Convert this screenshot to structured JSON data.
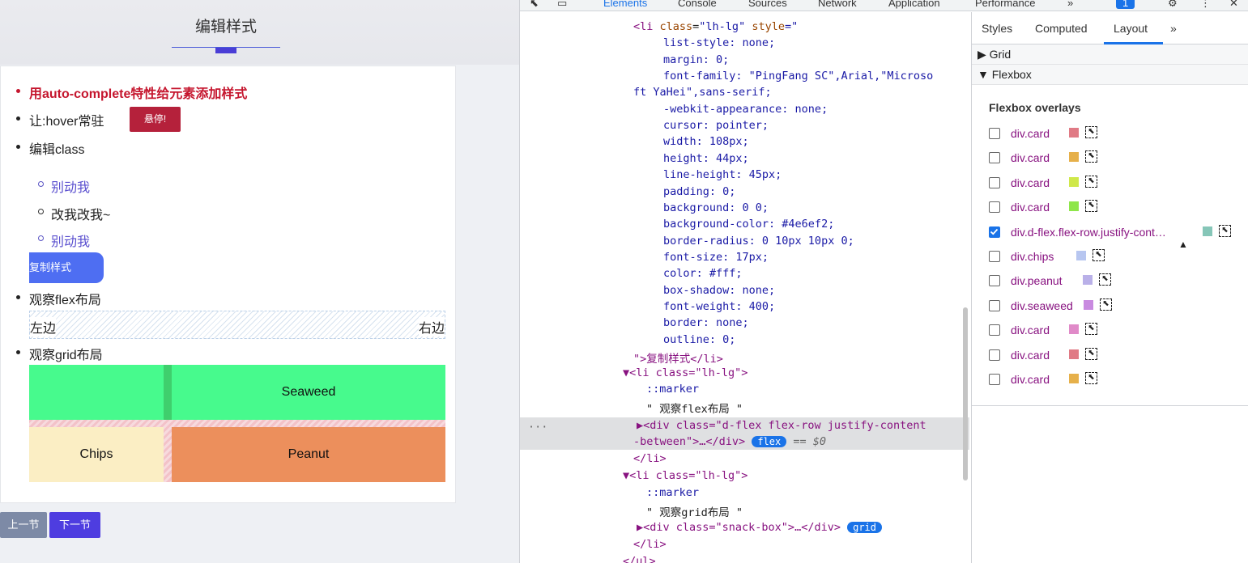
{
  "page": {
    "title": "编辑样式",
    "items": {
      "autocomplete": "用auto-complete特性给元素添加样式",
      "hover": "让:hover常驻",
      "hover_btn": "悬停!",
      "edit_class": "编辑class",
      "sub1": "别动我",
      "sub2": "改我改我~",
      "sub3": "别动我",
      "copy_btn": "复制样式",
      "flex_title": "观察flex布局",
      "flex_left": "左边",
      "flex_right": "右边",
      "grid_title": "观察grid布局",
      "seaweed": "Seaweed",
      "chips": "Chips",
      "peanut": "Peanut"
    },
    "prev": "上一节",
    "next": "下一节"
  },
  "devtools": {
    "tabs": [
      "Elements",
      "Console",
      "Sources",
      "Network",
      "Application",
      "Performance",
      "»"
    ],
    "issues_count": "1",
    "code": {
      "l1_tag": "<li ",
      "l1_attr": "class",
      "l1_val": "\"lh-lg\"",
      "l1_style": " style",
      "l1_eq": "=\"",
      "css1": "list-style: none;",
      "css2": "margin: 0;",
      "css3": "font-family: \"PingFang SC\",Arial,\"Microso",
      "css3b": "ft YaHei\",sans-serif;",
      "css4": "-webkit-appearance: none;",
      "css5": "cursor: pointer;",
      "css6": "width: 108px;",
      "css7": "height: 44px;",
      "css8": "line-height: 45px;",
      "css9": "padding: 0;",
      "css10": "background: 0 0;",
      "css11": "background-color: #4e6ef2;",
      "css12": "border-radius: 0 10px 10px 0;",
      "css13": "font-size: 17px;",
      "css14": "color: #fff;",
      "css15": "box-shadow: none;",
      "css16": "font-weight: 400;",
      "css17": "border: none;",
      "css18": "outline: 0;",
      "close1": "\">复制样式</li>",
      "li2": "▼<li class=\"lh-lg\">",
      "marker1": "::marker",
      "text1": "\" 观察flex布局 \"",
      "div1a": "▶<div class=\"d-flex flex-row justify-content",
      "div1b": "-between\">…</div>",
      "flex_badge": "flex",
      "eq0": "== $0",
      "endli1": "</li>",
      "li3": "▼<li class=\"lh-lg\">",
      "marker2": "::marker",
      "text2": "\" 观察grid布局 \"",
      "div2": "▶<div class=\"snack-box\">…</div>",
      "grid_badge": "grid",
      "endli2": "</li>",
      "endul": "</ul>",
      "dots": "···"
    },
    "side": {
      "tabs": [
        "Styles",
        "Computed",
        "Layout",
        "»"
      ],
      "grid": "▶ Grid",
      "flexbox": "▼ Flexbox",
      "overlays_title": "Flexbox overlays",
      "overlays": [
        {
          "label": "div.card",
          "color": "#e07a85",
          "checked": false
        },
        {
          "label": "div.card",
          "color": "#e6b04a",
          "checked": false
        },
        {
          "label": "div.card",
          "color": "#cfe84a",
          "checked": false
        },
        {
          "label": "div.card",
          "color": "#8ee64a",
          "checked": false
        },
        {
          "label": "div.d-flex.flex-row.justify-cont…",
          "color": "#86c6b8",
          "checked": true
        },
        {
          "label": "div.chips",
          "color": "#b7c6f0",
          "checked": false
        },
        {
          "label": "div.peanut",
          "color": "#b9b0e8",
          "checked": false
        },
        {
          "label": "div.seaweed",
          "color": "#c98ae0",
          "checked": false
        },
        {
          "label": "div.card",
          "color": "#e08ac8",
          "checked": false
        },
        {
          "label": "div.card",
          "color": "#e07a85",
          "checked": false
        },
        {
          "label": "div.card",
          "color": "#e6b04a",
          "checked": false
        }
      ]
    }
  }
}
